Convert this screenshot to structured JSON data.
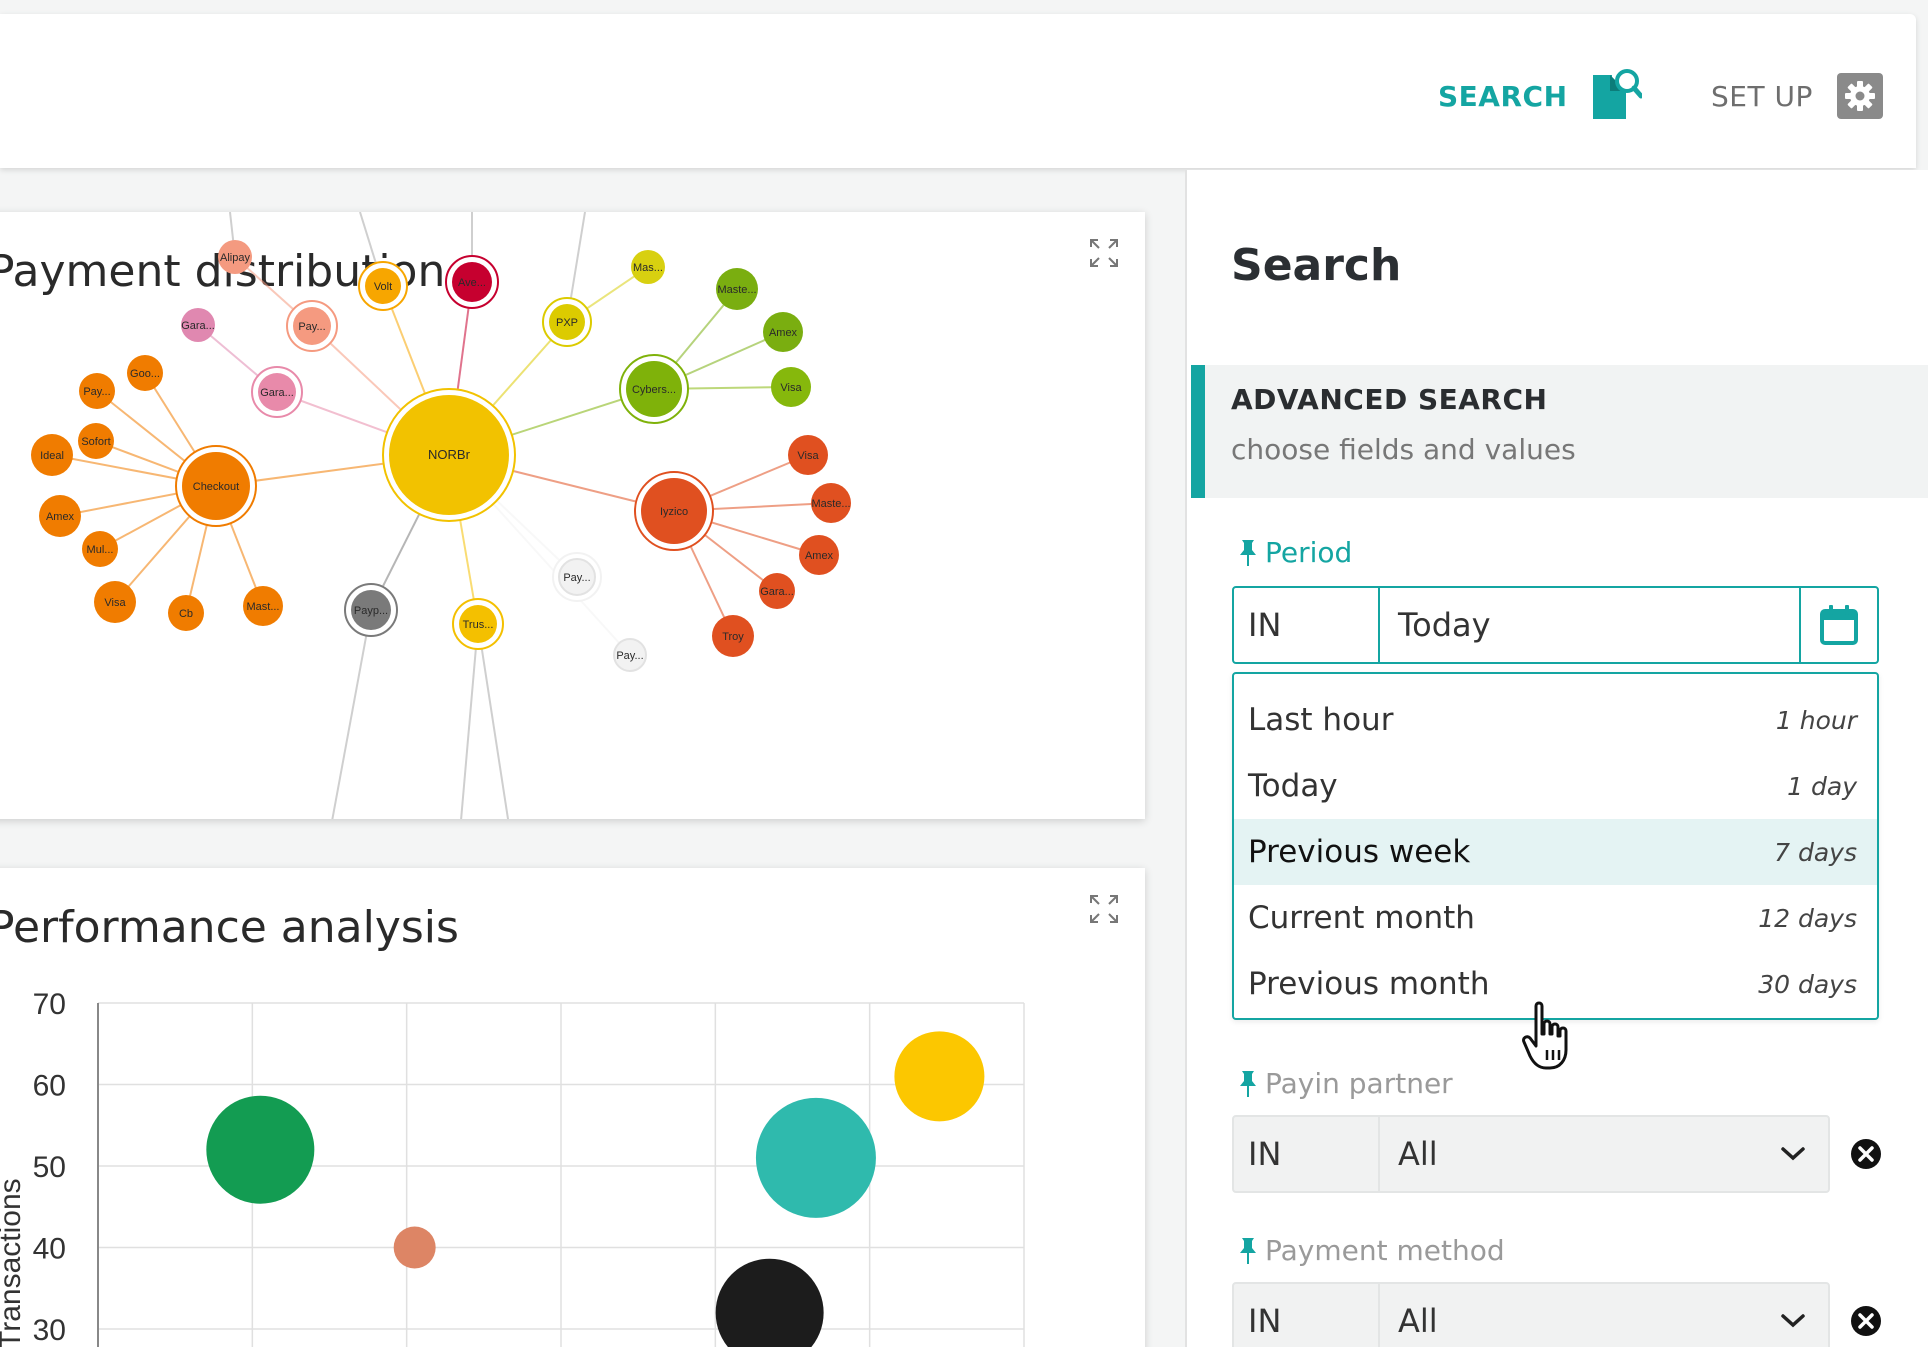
{
  "header": {
    "search_label": "SEARCH",
    "setup_label": "SET UP"
  },
  "payment_distribution": {
    "title": "Payment distribution",
    "nodes": [
      {
        "label": "NORBr",
        "color": "#f2c200"
      },
      {
        "label": "Checkout",
        "color": "#f07c00"
      },
      {
        "label": "Iyzico",
        "color": "#e05020"
      },
      {
        "label": "Cybers...",
        "color": "#7fb20a"
      },
      {
        "label": "PXP",
        "color": "#dccb00"
      },
      {
        "label": "Volt",
        "color": "#f7a600"
      },
      {
        "label": "Ave...",
        "color": "#c6002f"
      },
      {
        "label": "Pay...",
        "color": "#f59a80"
      },
      {
        "label": "Gara...",
        "color": "#e88aaa"
      },
      {
        "label": "Gara...",
        "color": "#e088b0"
      },
      {
        "label": "Alipay",
        "color": "#f49a80"
      },
      {
        "label": "Mas...",
        "color": "#d8d010"
      },
      {
        "label": "Maste...",
        "color": "#7aae10"
      },
      {
        "label": "Amex",
        "color": "#7aae10"
      },
      {
        "label": "Visa",
        "color": "#86b80c"
      },
      {
        "label": "Visa",
        "color": "#e05020"
      },
      {
        "label": "Maste...",
        "color": "#e05020"
      },
      {
        "label": "Amex",
        "color": "#e05020"
      },
      {
        "label": "Gara...",
        "color": "#e05020"
      },
      {
        "label": "Troy",
        "color": "#e05020"
      },
      {
        "label": "Goo...",
        "color": "#f07c00"
      },
      {
        "label": "Pay...",
        "color": "#f07c00"
      },
      {
        "label": "Sofort",
        "color": "#f07c00"
      },
      {
        "label": "Ideal",
        "color": "#f07c00"
      },
      {
        "label": "Amex",
        "color": "#f07c00"
      },
      {
        "label": "Mul...",
        "color": "#f07c00"
      },
      {
        "label": "Visa",
        "color": "#f07c00"
      },
      {
        "label": "Cb",
        "color": "#f07c00"
      },
      {
        "label": "Mast...",
        "color": "#f07c00"
      },
      {
        "label": "Payp...",
        "color": "#7a7a7a"
      },
      {
        "label": "Trus...",
        "color": "#f4c000"
      },
      {
        "label": "Pay...",
        "color": "#f2f2f2"
      },
      {
        "label": "Pay...",
        "color": "#f2f2f2"
      }
    ]
  },
  "performance": {
    "title": "Performance analysis",
    "ylabel": "Transactions",
    "y_ticks": [
      "70",
      "60",
      "50",
      "40",
      "30"
    ]
  },
  "chart_data": {
    "type": "scatter",
    "title": "Performance analysis",
    "ylabel": "Transactions",
    "ylim": [
      25,
      70
    ],
    "points": [
      {
        "x": 1,
        "y": 52,
        "r": 9,
        "color": "#139c52"
      },
      {
        "x": 2,
        "y": 40,
        "r": 3.5,
        "color": "#dd8565"
      },
      {
        "x": 4.3,
        "y": 32,
        "r": 9,
        "color": "#1c1c1c"
      },
      {
        "x": 4.6,
        "y": 51,
        "r": 10,
        "color": "#2fbaad"
      },
      {
        "x": 5.4,
        "y": 61,
        "r": 7.5,
        "color": "#fcc700"
      }
    ]
  },
  "search_panel": {
    "title": "Search",
    "advanced_title": "ADVANCED SEARCH",
    "advanced_subtitle": "choose fields and values",
    "period": {
      "label": "Period",
      "operator": "IN",
      "value": "Today",
      "options": [
        {
          "label": "Last hour",
          "duration": "1 hour"
        },
        {
          "label": "Today",
          "duration": "1 day"
        },
        {
          "label": "Previous week",
          "duration": "7 days"
        },
        {
          "label": "Current month",
          "duration": "12 days"
        },
        {
          "label": "Previous month",
          "duration": "30 days"
        }
      ]
    },
    "payin_partner": {
      "label": "Payin partner",
      "operator": "IN",
      "value": "All"
    },
    "payment_method": {
      "label": "Payment method",
      "operator": "IN",
      "value": "All"
    }
  },
  "colors": {
    "accent": "#14a5a2",
    "highlight": "#e4f3f3"
  }
}
